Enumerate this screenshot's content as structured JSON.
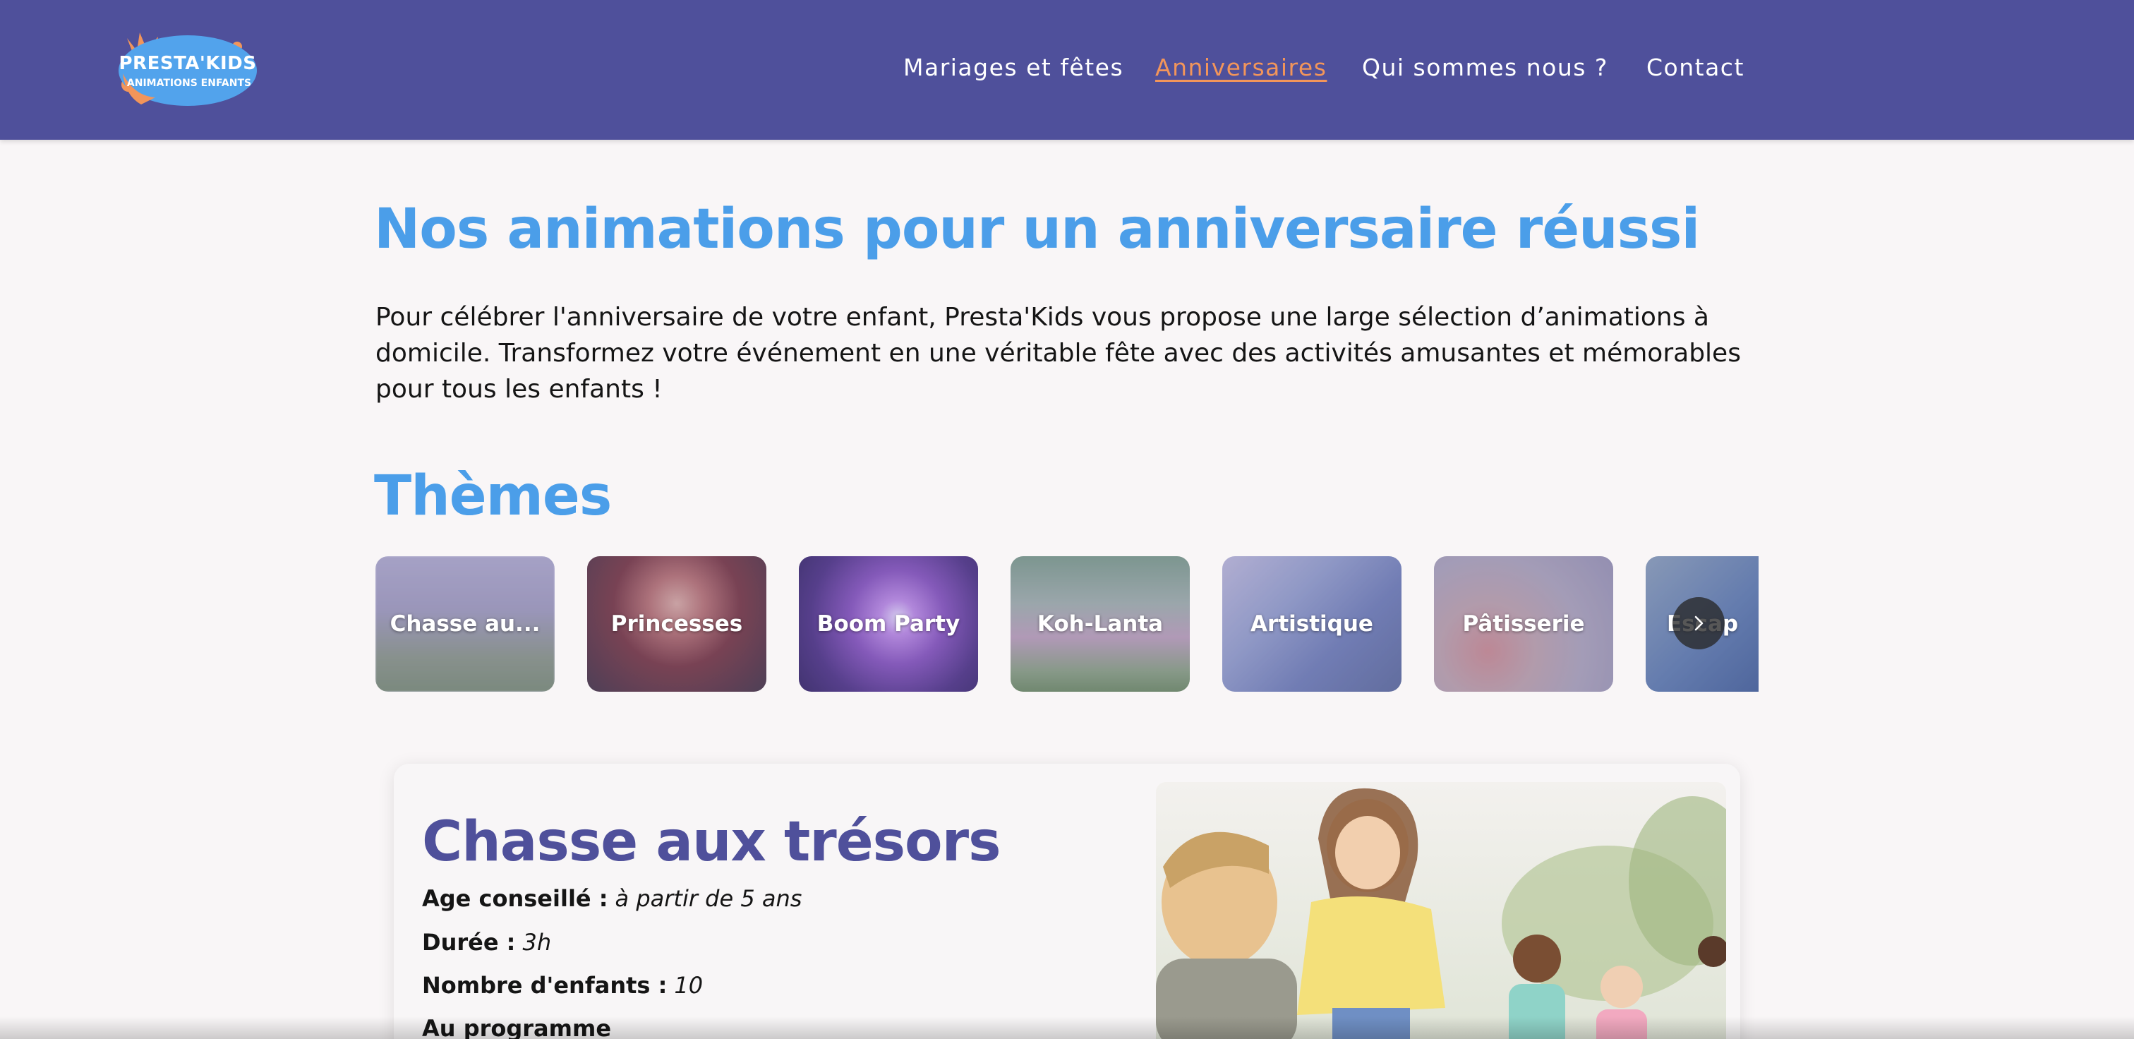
{
  "header": {
    "logo": {
      "line1": "PRESTA'KIDS",
      "line2": "ANIMATIONS ENFANTS"
    },
    "nav": [
      {
        "label": "Mariages et fêtes",
        "active": false
      },
      {
        "label": "Anniversaires",
        "active": true
      },
      {
        "label": "Qui sommes nous ?",
        "active": false
      },
      {
        "label": "Contact",
        "active": false
      }
    ],
    "colors": {
      "background": "#4f509b",
      "active_link": "#f2955a",
      "link": "#ffffff"
    }
  },
  "main": {
    "title": "Nos animations pour un anniversaire réussi",
    "intro": "Pour célébrer l'anniversaire de votre enfant, Presta'Kids vous propose une large sélection d’animations à domicile. Transformez votre événement en une véritable fête avec des activités amusantes et mémorables pour tous les enfants !",
    "themes_title": "Thèmes",
    "title_color": "#4b9ee9"
  },
  "themes": [
    {
      "label": "Chasse au...",
      "icon": "treasure-hunt-photo"
    },
    {
      "label": "Princesses",
      "icon": "princess-photo"
    },
    {
      "label": "Boom Party",
      "icon": "party-lights-photo"
    },
    {
      "label": "Koh-Lanta",
      "icon": "kids-running-photo"
    },
    {
      "label": "Artistique",
      "icon": "painting-photo"
    },
    {
      "label": "Pâtisserie",
      "icon": "baking-photo"
    },
    {
      "label": "Escap",
      "icon": "escape-game-photo"
    }
  ],
  "carousel": {
    "next_icon": "chevron-right-icon"
  },
  "detail": {
    "title": "Chasse aux trésors",
    "title_color": "#4f509b",
    "rows": [
      {
        "key": "Age conseillé :",
        "value": "à partir de 5 ans"
      },
      {
        "key": "Durée :",
        "value": "3h"
      },
      {
        "key": "Nombre d'enfants :",
        "value": "10"
      },
      {
        "key": "Au programme",
        "value": ""
      }
    ],
    "image_icon": "children-running-photo"
  }
}
